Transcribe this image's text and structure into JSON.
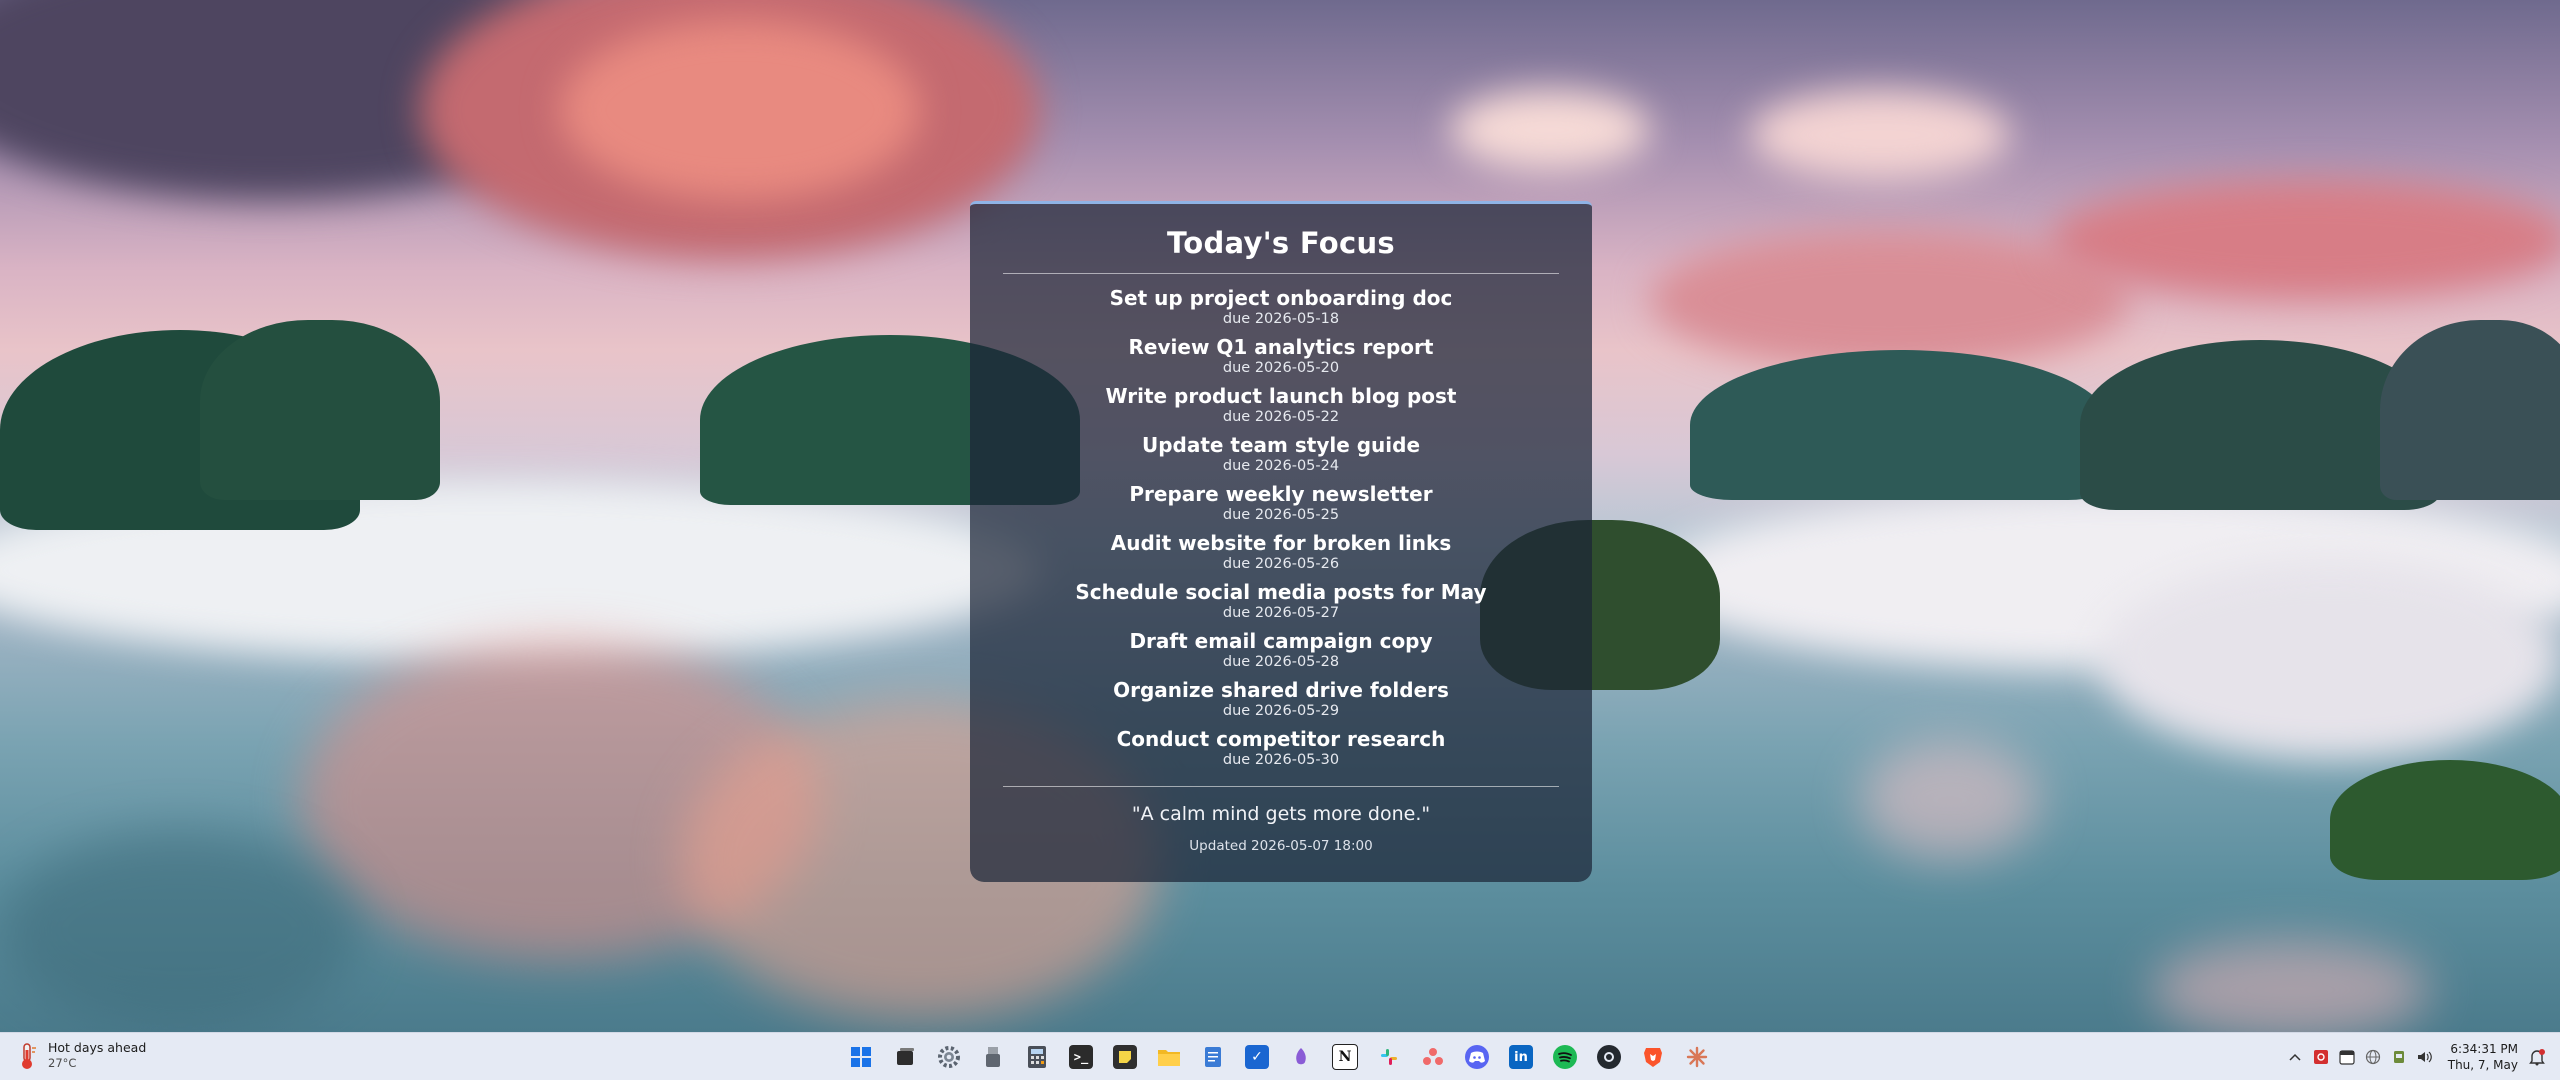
{
  "widget": {
    "title": "Today's Focus",
    "tasks": [
      {
        "title": "Set up project onboarding doc",
        "due": "due 2026-05-18"
      },
      {
        "title": "Review Q1 analytics report",
        "due": "due 2026-05-20"
      },
      {
        "title": "Write product launch blog post",
        "due": "due 2026-05-22"
      },
      {
        "title": "Update team style guide",
        "due": "due 2026-05-24"
      },
      {
        "title": "Prepare weekly newsletter",
        "due": "due 2026-05-25"
      },
      {
        "title": "Audit website for broken links",
        "due": "due 2026-05-26"
      },
      {
        "title": "Schedule social media posts for May",
        "due": "due 2026-05-27"
      },
      {
        "title": "Draft email campaign copy",
        "due": "due 2026-05-28"
      },
      {
        "title": "Organize shared drive folders",
        "due": "due 2026-05-29"
      },
      {
        "title": "Conduct competitor research",
        "due": "due 2026-05-30"
      }
    ],
    "quote": "\"A calm mind gets more done.\"",
    "updated": "Updated 2026-05-07 18:00"
  },
  "taskbar": {
    "weather": {
      "description": "Hot days ahead",
      "temperature": "27°C",
      "icon": "thermometer-icon"
    },
    "apps": [
      {
        "name": "start-button",
        "icon": "windows-logo-icon",
        "color": "#1f6fd6"
      },
      {
        "name": "task-view-button",
        "icon": "task-view-icon",
        "color": "#2d2d2d"
      },
      {
        "name": "settings-app",
        "icon": "gear-icon",
        "color": "#5b6470"
      },
      {
        "name": "usb-app",
        "icon": "usb-drive-icon",
        "color": "#6e6e6e"
      },
      {
        "name": "calculator-app",
        "icon": "calculator-icon",
        "color": "#4a4f58"
      },
      {
        "name": "terminal-app",
        "icon": "terminal-icon",
        "color": "#2b2b2b"
      },
      {
        "name": "sticky-notes-app",
        "icon": "sticky-notes-icon",
        "color": "#2f2f2f"
      },
      {
        "name": "file-explorer-app",
        "icon": "folder-icon",
        "color": "#f2b824"
      },
      {
        "name": "notepad-app",
        "icon": "notepad-icon",
        "color": "#3a7bd5"
      },
      {
        "name": "todo-app",
        "icon": "checkmark-icon",
        "color": "#1a66d1"
      },
      {
        "name": "copilot-app",
        "icon": "copilot-icon",
        "color": "#8a5cd6"
      },
      {
        "name": "notion-app",
        "icon": "notion-icon",
        "color": "#ffffff"
      },
      {
        "name": "slack-app",
        "icon": "slack-icon",
        "color": "#e01e5a"
      },
      {
        "name": "asana-app",
        "icon": "asana-icon",
        "color": "#f06a6a"
      },
      {
        "name": "discord-app",
        "icon": "discord-icon",
        "color": "#5865f2"
      },
      {
        "name": "linkedin-app",
        "icon": "linkedin-icon",
        "color": "#0a66c2"
      },
      {
        "name": "spotify-app",
        "icon": "spotify-icon",
        "color": "#1db954"
      },
      {
        "name": "github-app",
        "icon": "github-icon",
        "color": "#24292f"
      },
      {
        "name": "brave-app",
        "icon": "brave-lion-icon",
        "color": "#fb542b"
      },
      {
        "name": "claude-app",
        "icon": "claude-sparkle-icon",
        "color": "#d97757"
      }
    ],
    "tray": {
      "icons": [
        "chevron-up-icon",
        "pdf-icon",
        "calendar-icon",
        "globe-icon",
        "plug-icon",
        "speaker-icon"
      ],
      "time": "6:34:31 PM",
      "date": "Thu, 7, May",
      "notification_icon": "bell-icon"
    }
  }
}
